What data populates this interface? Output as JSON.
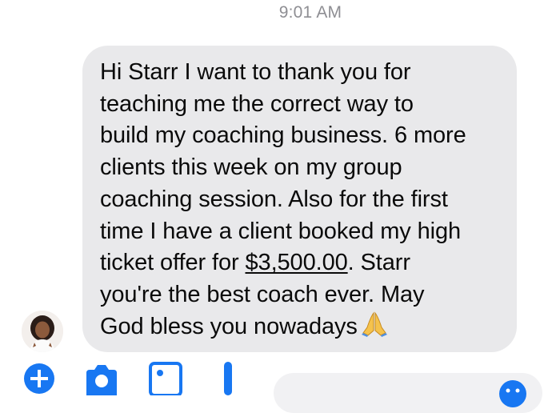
{
  "thread": {
    "timestamp": "9:01 AM"
  },
  "message": {
    "lines": [
      "Hi Starr I want to thank you for",
      "teaching me the correct way to",
      "build my coaching business. 6 more",
      "clients this week on my group",
      "coaching session. Also for the first",
      "time I have a client booked my high"
    ],
    "line7_prefix": "ticket offer for ",
    "line7_link": "$3,500.00",
    "line7_suffix": ". Starr",
    "line8": "you're the best coach ever. May",
    "line9": "God bless you nowadays",
    "emoji": "folded-hands-emoji"
  },
  "composer": {
    "input_value": ""
  },
  "colors": {
    "bubble": "#e9e9eb",
    "accent": "#1877f2",
    "timestamp": "#8e8e93"
  },
  "icons": [
    "avatar",
    "add-icon",
    "camera-icon",
    "photo-icon",
    "microphone-icon",
    "emoji-icon"
  ]
}
